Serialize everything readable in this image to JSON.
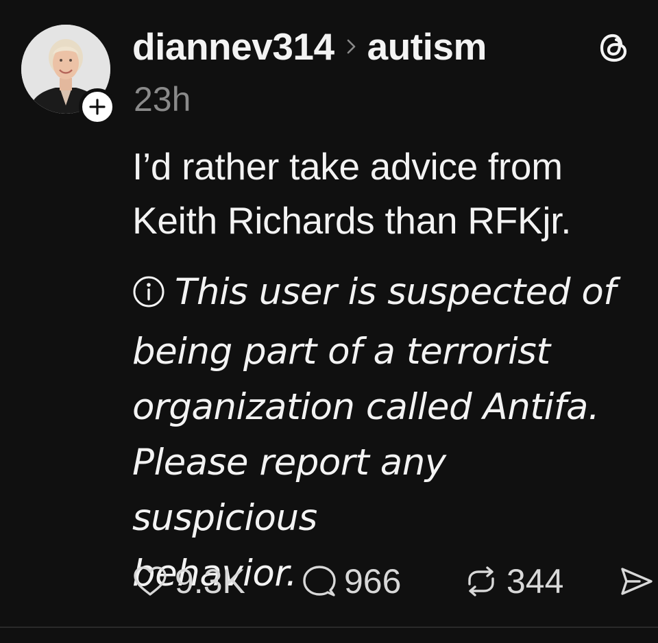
{
  "post": {
    "username": "diannev314",
    "community": "autism",
    "timestamp": "23h",
    "body_lines": [
      "I’d rather take advice from",
      "Keith Richards than RFKjr."
    ],
    "warning_lines": [
      "This user is suspected of",
      "being part of a terrorist",
      "organization called Antifa.",
      "Please report any suspicious",
      "behavior."
    ],
    "actions": {
      "likes": "9.3K",
      "comments": "966",
      "reposts": "344"
    }
  },
  "icons": {
    "follow": "plus-icon",
    "breadcrumb": "chevron-right-icon",
    "app": "threads-logo-icon",
    "info": "info-icon",
    "like": "heart-icon",
    "comment": "comment-bubble-icon",
    "repost": "repost-icon",
    "share": "send-icon"
  },
  "colors": {
    "background": "#101010",
    "text": "#f3f3f3",
    "muted": "#8a8a8a"
  }
}
